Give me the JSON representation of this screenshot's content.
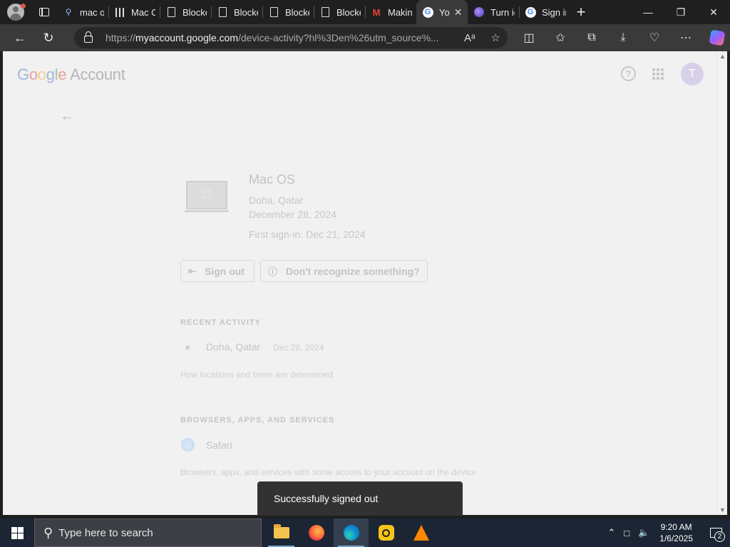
{
  "browser": {
    "tabs": [
      {
        "title": "mac os",
        "icon": "search-icon"
      },
      {
        "title": "Mac OS",
        "icon": "books-icon"
      },
      {
        "title": "Blocked",
        "icon": "document-icon"
      },
      {
        "title": "Blocked",
        "icon": "document-icon"
      },
      {
        "title": "Blocked",
        "icon": "document-icon"
      },
      {
        "title": "Blocked",
        "icon": "document-icon"
      },
      {
        "title": "Making",
        "icon": "gmail-icon"
      },
      {
        "title": "Yo",
        "icon": "google-icon",
        "active": true
      },
      {
        "title": "Turn id",
        "icon": "globe-icon"
      },
      {
        "title": "Sign in",
        "icon": "google-icon"
      }
    ],
    "url_prefix": "https://",
    "url_host": "myaccount.google.com",
    "url_rest": "/device-activity?hl%3Den%26utm_source%..."
  },
  "header": {
    "logo_letters": [
      "G",
      "o",
      "o",
      "g",
      "l",
      "e"
    ],
    "logo_suffix": "Account",
    "help_glyph": "?",
    "avatar_letter": "T"
  },
  "device": {
    "name": "Mac OS",
    "location": "Doha, Qatar",
    "last_seen": "December 28, 2024",
    "first_sign_in": "First sign-in: Dec 21, 2024",
    "sign_out_label": "Sign out",
    "dont_recognize_label": "Don't recognize something?"
  },
  "recent_activity": {
    "header": "RECENT ACTIVITY",
    "location": "Doha, Qatar",
    "date": "Dec 28, 2024",
    "note": "How locations and times are determined"
  },
  "apps_section": {
    "header": "BROWSERS, APPS, AND SERVICES",
    "item": "Safari",
    "note": "Browsers, apps, and services with some access to your account on the device"
  },
  "toast": {
    "message": "Successfully signed out"
  },
  "taskbar": {
    "search_placeholder": "Type here to search",
    "time": "9:20 AM",
    "date": "1/6/2025",
    "notification_count": "2"
  }
}
